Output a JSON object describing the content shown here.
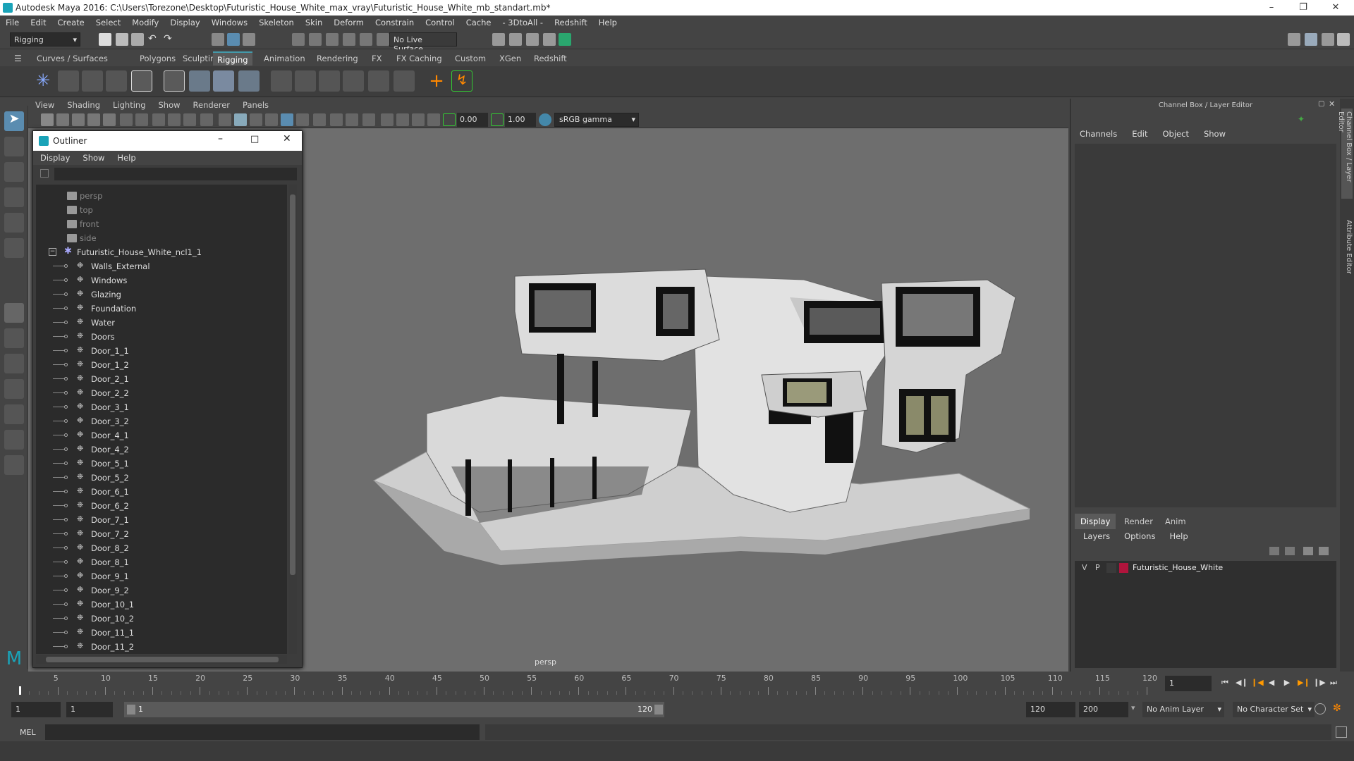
{
  "window": {
    "title": "Autodesk Maya 2016: C:\\Users\\Torezone\\Desktop\\Futuristic_House_White_max_vray\\Futuristic_House_White_mb_standart.mb*"
  },
  "menubar": {
    "items": [
      "File",
      "Edit",
      "Create",
      "Select",
      "Modify",
      "Display",
      "Windows",
      "Skeleton",
      "Skin",
      "Deform",
      "Constrain",
      "Control",
      "Cache",
      "- 3DtoAll -",
      "Redshift",
      "Help"
    ]
  },
  "statusline": {
    "mode": "Rigging",
    "live_surface": "No Live Surface"
  },
  "shelf": {
    "tabs": [
      "Curves / Surfaces",
      "Polygons",
      "Sculpting",
      "Rigging",
      "Animation",
      "Rendering",
      "FX",
      "FX Caching",
      "Custom",
      "XGen",
      "Redshift"
    ],
    "active_tab": "Rigging"
  },
  "viewport": {
    "menu": [
      "View",
      "Shading",
      "Lighting",
      "Show",
      "Renderer",
      "Panels"
    ],
    "exposure": "0.00",
    "gamma": "1.00",
    "color_space": "sRGB gamma",
    "camera_label": "persp"
  },
  "outliner": {
    "title": "Outliner",
    "menu": [
      "Display",
      "Show",
      "Help"
    ],
    "cameras": [
      "persp",
      "top",
      "front",
      "side"
    ],
    "root": "Futuristic_House_White_ncl1_1",
    "children": [
      "Walls_External",
      "Windows",
      "Glazing",
      "Foundation",
      "Water",
      "Doors",
      "Door_1_1",
      "Door_1_2",
      "Door_2_1",
      "Door_2_2",
      "Door_3_1",
      "Door_3_2",
      "Door_4_1",
      "Door_4_2",
      "Door_5_1",
      "Door_5_2",
      "Door_6_1",
      "Door_6_2",
      "Door_7_1",
      "Door_7_2",
      "Door_8_2",
      "Door_8_1",
      "Door_9_1",
      "Door_9_2",
      "Door_10_1",
      "Door_10_2",
      "Door_11_1",
      "Door_11_2"
    ]
  },
  "channel_box": {
    "title": "Channel Box / Layer Editor",
    "menu": [
      "Channels",
      "Edit",
      "Object",
      "Show"
    ],
    "layer_tabs": [
      "Display",
      "Render",
      "Anim"
    ],
    "active_layer_tab": "Display",
    "layer_menu": [
      "Layers",
      "Options",
      "Help"
    ],
    "layer": {
      "v": "V",
      "p": "P",
      "name": "Futuristic_House_White",
      "color": "#b0143c"
    }
  },
  "side_tabs": [
    "Channel Box / Layer Editor",
    "Attribute Editor"
  ],
  "timeline": {
    "ticks": [
      "1",
      "5",
      "10",
      "15",
      "20",
      "25",
      "30",
      "35",
      "40",
      "45",
      "50",
      "55",
      "60",
      "65",
      "70",
      "75",
      "80",
      "85",
      "90",
      "95",
      "100",
      "105",
      "110",
      "115",
      "120"
    ],
    "current_frame": "1"
  },
  "range": {
    "start": "1",
    "playback_start": "1",
    "slider_start": "1",
    "slider_end": "120",
    "playback_end": "120",
    "end": "200",
    "anim_layer": "No Anim Layer",
    "character_set": "No Character Set"
  },
  "cmdline": {
    "label": "MEL"
  },
  "colors": {
    "accent": "#4aa3c8",
    "panel": "#444444",
    "viewport": "#6e6e6e"
  }
}
